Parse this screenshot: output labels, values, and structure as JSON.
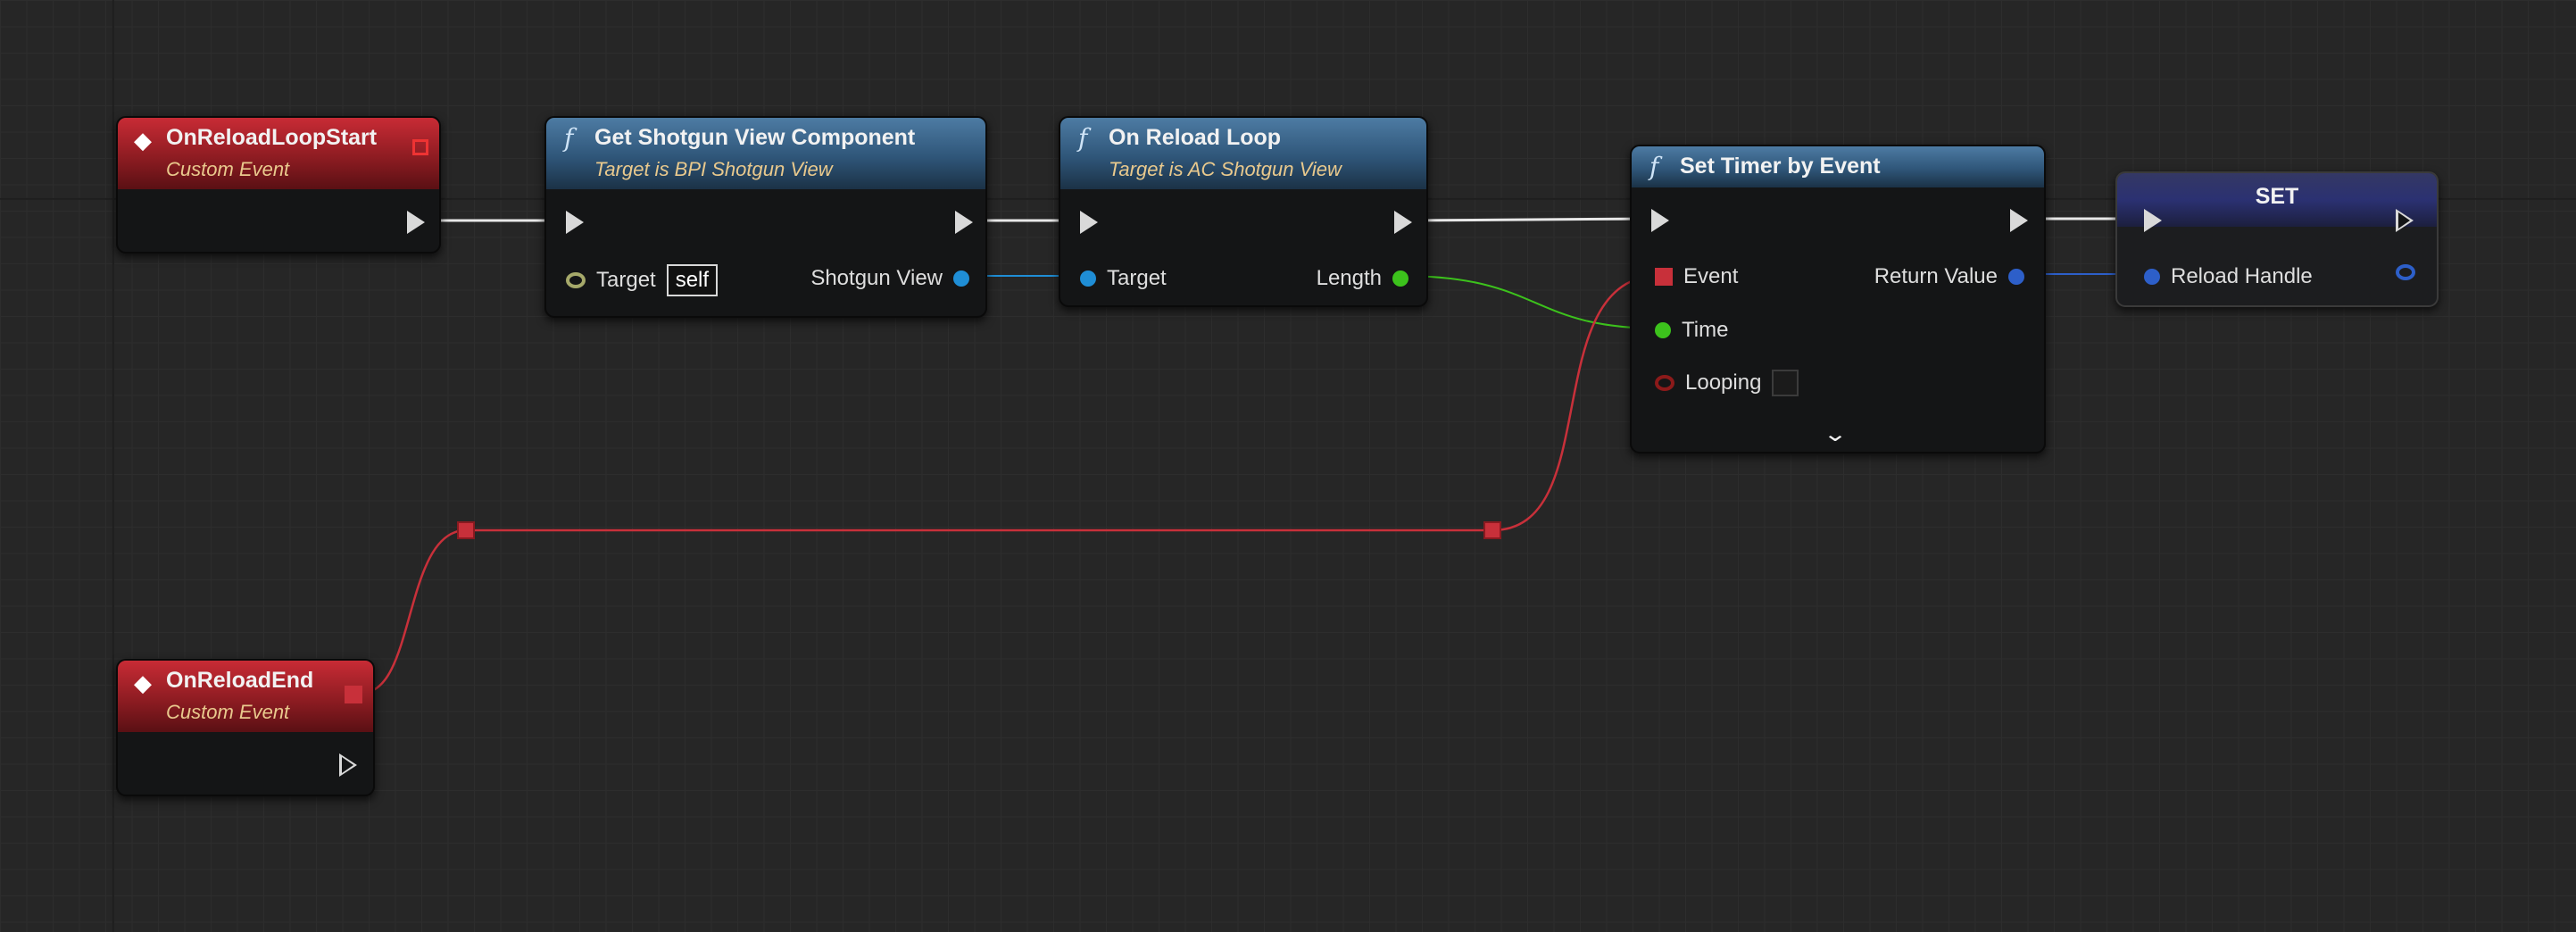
{
  "graph": {
    "nodes": {
      "on_reload_loop_start": {
        "title": "OnReloadLoopStart",
        "subtitle": "Custom Event"
      },
      "get_shotgun_view": {
        "title": "Get Shotgun View Component",
        "subtitle": "Target is BPI Shotgun View",
        "target_label": "Target",
        "target_value": "self",
        "output_label": "Shotgun View"
      },
      "on_reload_loop": {
        "title": "On Reload Loop",
        "subtitle": "Target is AC Shotgun View",
        "target_label": "Target",
        "output_label": "Length"
      },
      "set_timer": {
        "title": "Set Timer by Event",
        "event_label": "Event",
        "time_label": "Time",
        "looping_label": "Looping",
        "return_label": "Return Value",
        "expand_icon": "chevron-down-icon"
      },
      "set_var": {
        "title": "SET",
        "var_label": "Reload Handle"
      },
      "on_reload_end": {
        "title": "OnReloadEnd",
        "subtitle": "Custom Event"
      }
    },
    "icons": {
      "event": "event-diamond-icon",
      "function": "function-f-icon"
    },
    "colors": {
      "event_header": "#c82b35",
      "function_header": "#2f5679",
      "set_header": "#2b3172",
      "exec_wire": "#e8e8e8",
      "object_pin": "#1f8ed6",
      "float_pin": "#3cc21c",
      "delegate_pin": "#c8303a",
      "handle_pin": "#2d5fc9",
      "bool_pin": "#8c1a1a",
      "self_pin": "#a6a96a"
    }
  }
}
